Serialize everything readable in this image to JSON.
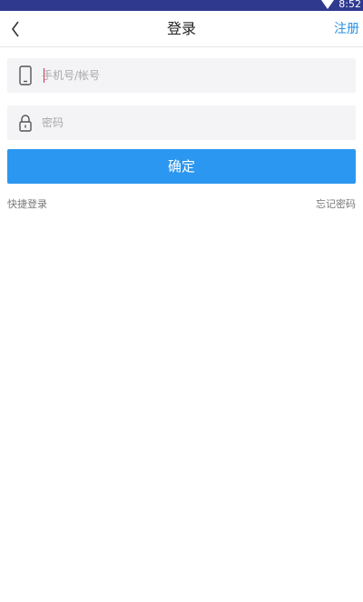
{
  "status_bar": {
    "time": "8:52"
  },
  "nav": {
    "title": "登录",
    "register_label": "注册"
  },
  "form": {
    "phone_placeholder": "手机号/帐号",
    "password_placeholder": "密码",
    "confirm_label": "确定"
  },
  "links": {
    "quick_login": "快捷登录",
    "forgot_password": "忘记密码"
  },
  "colors": {
    "status_bar": "#2f3a8f",
    "accent": "#2b97f0",
    "link": "#2a92e6",
    "field_bg": "#f4f4f6"
  }
}
